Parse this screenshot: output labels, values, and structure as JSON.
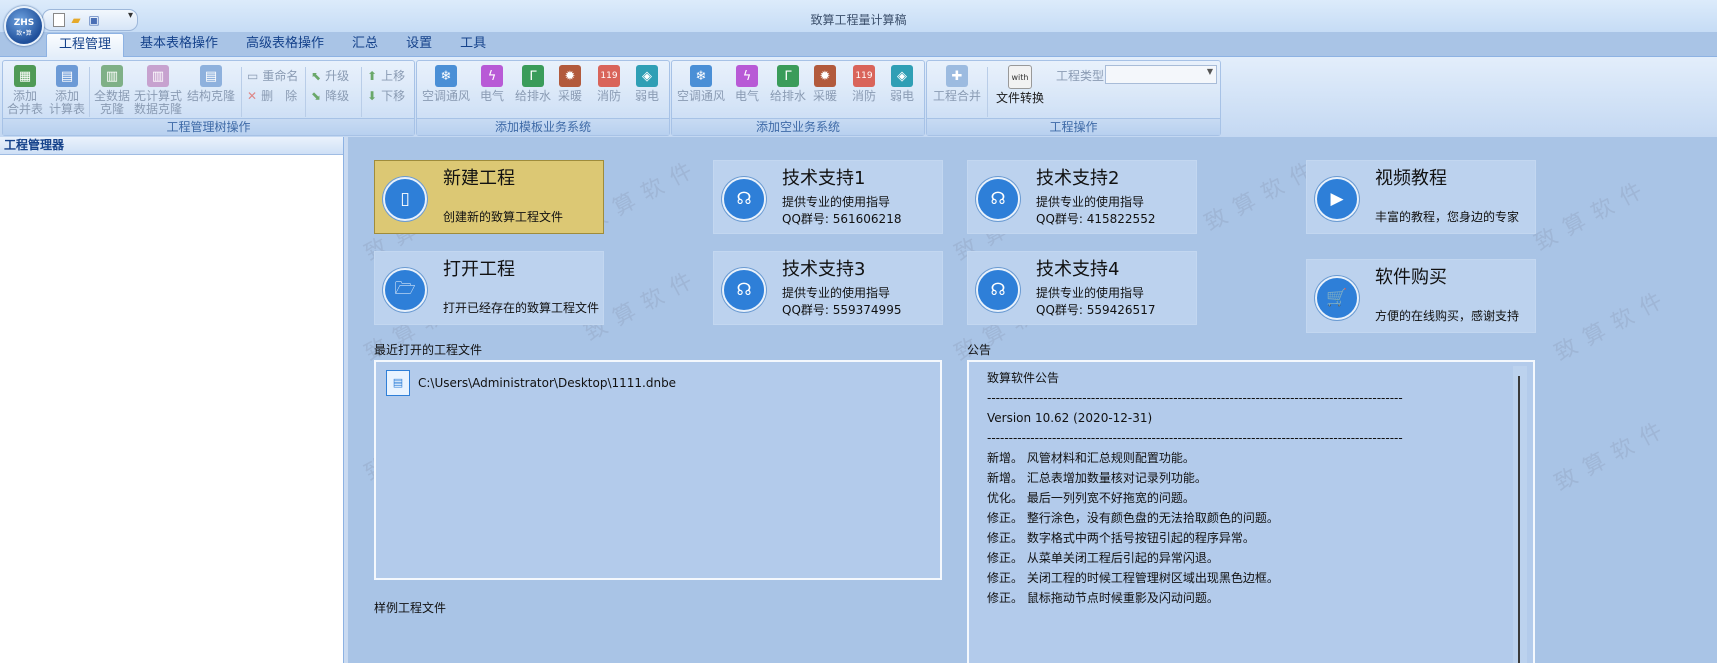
{
  "window": {
    "title": "致算工程量计算稿",
    "app_logo_text": "ZHS",
    "app_logo_sub": "致•算"
  },
  "qat": {
    "icons": [
      "new-file-icon",
      "open-folder-icon",
      "save-icon"
    ],
    "more": "▾"
  },
  "tabs": [
    {
      "label": "工程管理",
      "active": true
    },
    {
      "label": "基本表格操作",
      "active": false
    },
    {
      "label": "高级表格操作",
      "active": false
    },
    {
      "label": "汇总",
      "active": false
    },
    {
      "label": "设置",
      "active": false
    },
    {
      "label": "工具",
      "active": false
    }
  ],
  "ribbon": {
    "tree_group": {
      "label": "工程管理树操作",
      "add_summary": [
        "添加",
        "合并表"
      ],
      "add_calc": [
        "添加",
        "计算表"
      ],
      "clone_all": [
        "全数据",
        "克隆"
      ],
      "clone_noformula": [
        "无计算式",
        "数据克隆"
      ],
      "clone_struct": "结构克隆",
      "rename": "重命名",
      "delete": "删　除",
      "upgrade": "升级",
      "downgrade": "降级",
      "move_up": "上移",
      "move_down": "下移"
    },
    "template_group": {
      "label": "添加模板业务系统",
      "items": [
        "空调通风",
        "电气",
        "给排水",
        "采暖",
        "消防",
        "弱电"
      ]
    },
    "empty_group": {
      "label": "添加空业务系统",
      "items": [
        "空调通风",
        "电气",
        "给排水",
        "采暖",
        "消防",
        "弱电"
      ]
    },
    "project_group": {
      "label": "工程操作",
      "merge": "工程合并",
      "convert": "文件转换",
      "type_label": "工程类型",
      "type_value": ""
    },
    "colors": {
      "hvac": "#4a8fd6",
      "electric": "#b85ad6",
      "water": "#3a9c5a",
      "heating": "#b25a3c",
      "fire": "#d9645a",
      "weak": "#2f9fb5"
    }
  },
  "left_panel": {
    "title": "工程管理器"
  },
  "tiles": {
    "new_project": {
      "title": "新建工程",
      "desc": "创建新的致算工程文件"
    },
    "open_project": {
      "title": "打开工程",
      "desc": "打开已经存在的致算工程文件"
    },
    "support1": {
      "title": "技术支持1",
      "desc": "提供专业的使用指导",
      "qq": "QQ群号: 561606218"
    },
    "support2": {
      "title": "技术支持2",
      "desc": "提供专业的使用指导",
      "qq": "QQ群号: 415822552"
    },
    "support3": {
      "title": "技术支持3",
      "desc": "提供专业的使用指导",
      "qq": "QQ群号: 559374995"
    },
    "support4": {
      "title": "技术支持4",
      "desc": "提供专业的使用指导",
      "qq": "QQ群号: 559426517"
    },
    "video": {
      "title": "视频教程",
      "desc": "丰富的教程，您身边的专家"
    },
    "buy": {
      "title": "软件购买",
      "desc": "方便的在线购买，感谢支持"
    }
  },
  "watermark": "致算软件",
  "recent": {
    "label": "最近打开的工程文件",
    "files": [
      "C:\\Users\\Administrator\\Desktop\\1111.dnbe"
    ],
    "next_label": "样例工程文件"
  },
  "notice": {
    "label": "公告",
    "lines": [
      "致算软件公告",
      "------------------------------------------------------------------------------------------------",
      "Version 10.62  (2020-12-31)",
      "------------------------------------------------------------------------------------------------",
      "新增。  风管材料和汇总规则配置功能。",
      "新增。  汇总表增加数量核对记录列功能。",
      "优化。  最后一列列宽不好拖宽的问题。",
      "修正。  整行涂色，没有颜色盘的无法拾取颜色的问题。",
      "修正。  数字格式中两个括号按钮引起的程序异常。",
      "修正。  从菜单关闭工程后引起的异常闪退。",
      "修正。  关闭工程的时候工程管理树区域出现黑色边框。",
      "修正。  鼠标拖动节点时候重影及闪动问题。"
    ]
  }
}
